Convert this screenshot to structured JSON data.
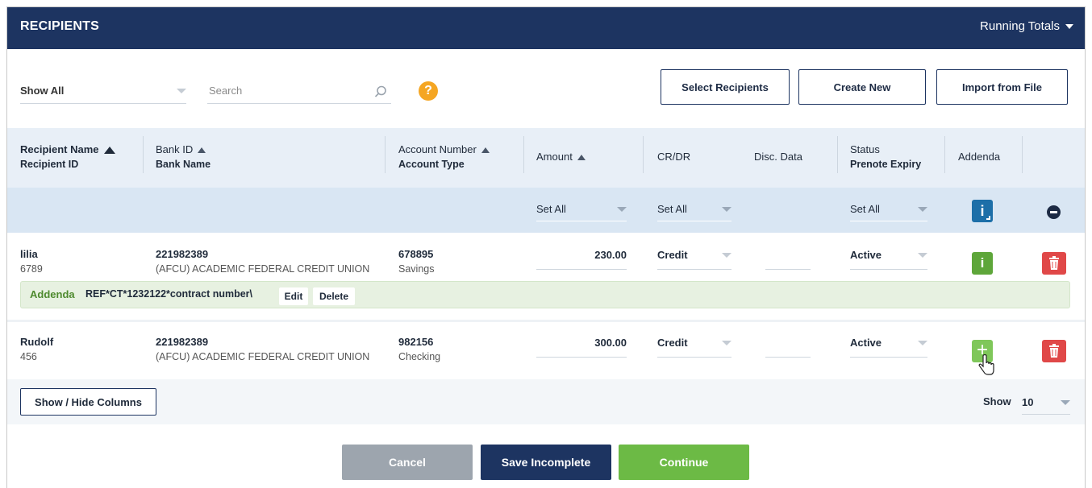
{
  "header": {
    "title": "RECIPIENTS",
    "running_totals": "Running Totals"
  },
  "filters": {
    "show": "Show All",
    "search_placeholder": "Search",
    "help": "?",
    "buttons": {
      "select": "Select Recipients",
      "create": "Create New",
      "import": "Import from File"
    }
  },
  "columns": {
    "recipient": {
      "main": "Recipient Name",
      "sub": "Recipient ID"
    },
    "bank": {
      "main": "Bank ID",
      "sub": "Bank Name"
    },
    "account": {
      "main": "Account Number",
      "sub": "Account Type"
    },
    "amount": {
      "main": "Amount"
    },
    "crdr": {
      "main": "CR/DR"
    },
    "disc": {
      "main": "Disc. Data"
    },
    "status": {
      "main": "Status",
      "sub": "Prenote Expiry"
    },
    "addenda": {
      "main": "Addenda"
    }
  },
  "set_all": {
    "amount": "Set All",
    "crdr": "Set All",
    "status": "Set All"
  },
  "rows": [
    {
      "name": "lilia",
      "id": "6789",
      "bank_id": "221982389",
      "bank_name": "(AFCU) ACADEMIC FEDERAL CREDIT UNION",
      "account": "678895",
      "account_type": "Savings",
      "amount": "230.00",
      "crdr": "Credit",
      "status": "Active",
      "addenda_icon": "info-icon"
    },
    {
      "name": "Rudolf",
      "id": "456",
      "bank_id": "221982389",
      "bank_name": "(AFCU) ACADEMIC FEDERAL CREDIT UNION",
      "account": "982156",
      "account_type": "Checking",
      "amount": "300.00",
      "crdr": "Credit",
      "status": "Active",
      "addenda_icon": "plus-icon"
    }
  ],
  "addenda": {
    "label": "Addenda",
    "value": "REF*CT*1232122*contract number\\",
    "edit": "Edit",
    "delete": "Delete"
  },
  "footer": {
    "show_hide": "Show / Hide Columns",
    "show_label": "Show",
    "page_size": "10"
  },
  "actions": {
    "cancel": "Cancel",
    "save": "Save Incomplete",
    "continue": "Continue"
  },
  "colors": {
    "navy": "#1d3461",
    "green": "#6cba45",
    "grey": "#9da5ae",
    "red": "#e04848",
    "orange": "#f5a623"
  }
}
